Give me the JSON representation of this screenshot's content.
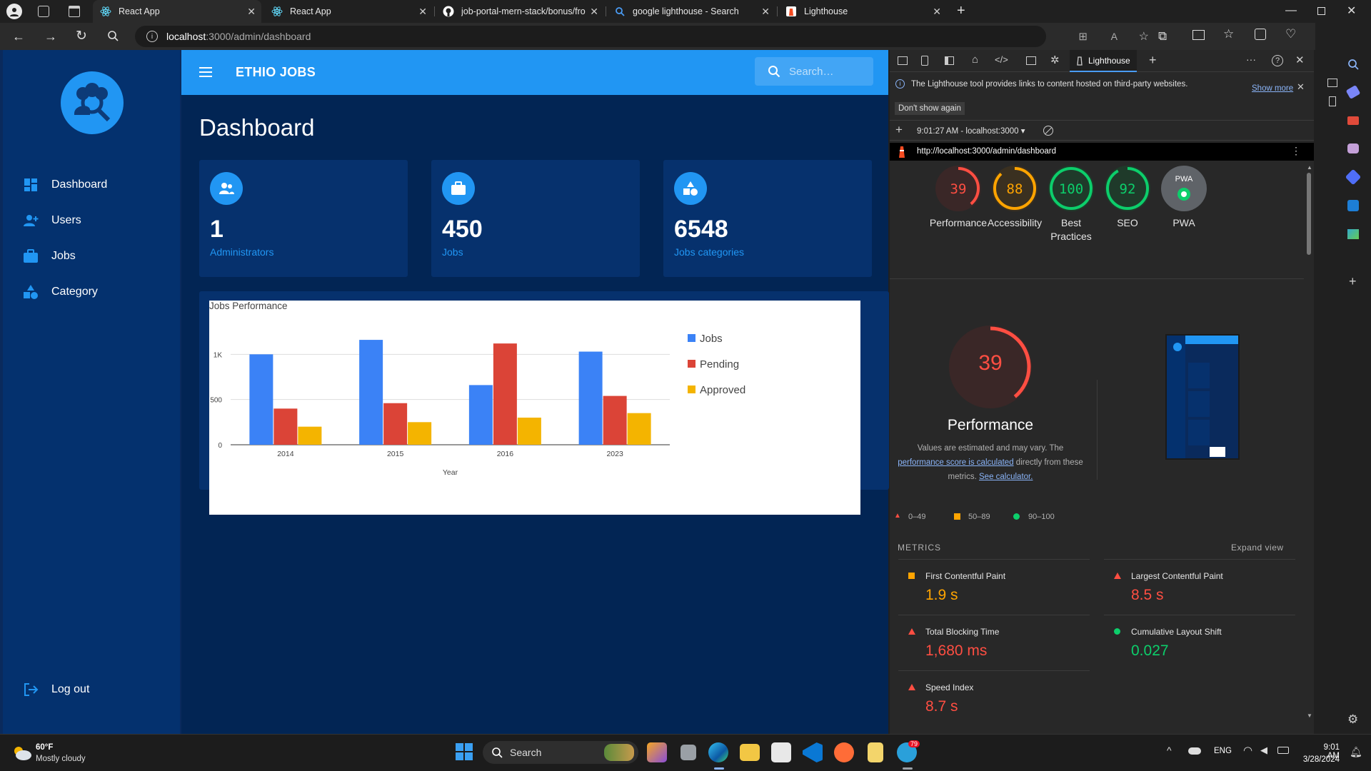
{
  "browser": {
    "tabs": [
      {
        "title": "React App"
      },
      {
        "title": "React App"
      },
      {
        "title": "job-portal-mern-stack/bonus/fro"
      },
      {
        "title": "google lighthouse - Search"
      },
      {
        "title": "Lighthouse"
      }
    ],
    "url_host": "localhost",
    "url_rest": ":3000/admin/dashboard"
  },
  "app": {
    "brand": "ETHIO JOBS",
    "search_placeholder": "Search…",
    "page_title": "Dashboard",
    "nav": [
      {
        "label": "Dashboard",
        "icon": "dashboard-icon"
      },
      {
        "label": "Users",
        "icon": "group-add-icon"
      },
      {
        "label": "Jobs",
        "icon": "work-icon"
      },
      {
        "label": "Category",
        "icon": "category-icon"
      }
    ],
    "logout": "Log out",
    "cards": [
      {
        "value": "1",
        "label": "Administrators",
        "icon": "supervisor-icon"
      },
      {
        "value": "450",
        "label": "Jobs",
        "icon": "work-icon"
      },
      {
        "value": "6548",
        "label": "Jobs categories",
        "icon": "category-icon"
      }
    ],
    "colors": {
      "primary": "#2196f3",
      "sidebar": "#04316e",
      "main": "#022554",
      "card": "#06316d"
    }
  },
  "chart_data": {
    "type": "bar",
    "title": "Jobs Performance",
    "xlabel": "Year",
    "ylabel": "",
    "categories": [
      "2014",
      "2015",
      "2016",
      "2023"
    ],
    "series": [
      {
        "name": "Jobs",
        "color": "#3b82f6",
        "values": [
          1000,
          1160,
          660,
          1030
        ]
      },
      {
        "name": "Pending",
        "color": "#db4437",
        "values": [
          400,
          460,
          1120,
          540
        ]
      },
      {
        "name": "Approved",
        "color": "#f4b400",
        "values": [
          200,
          250,
          300,
          350
        ]
      }
    ],
    "yticks": [
      "0",
      "500",
      "1K"
    ],
    "ylim": [
      0,
      1200
    ],
    "legend": "right",
    "grid": true
  },
  "devtools": {
    "panel_tab": "Lighthouse",
    "info": "The Lighthouse tool provides links to content hosted on third-party websites.",
    "show_more": "Show more",
    "dont_show": "Don't show again",
    "report_select": "9:01:27 AM - localhost:3000",
    "report_url": "http://localhost:3000/admin/dashboard",
    "scores": [
      {
        "label": "Performance",
        "value": "39",
        "score": 39,
        "color": "#ff4e42"
      },
      {
        "label": "Accessibility",
        "value": "88",
        "score": 88,
        "color": "#ffa400"
      },
      {
        "label": "Best Practices",
        "value": "100",
        "score": 100,
        "color": "#0cce6b"
      },
      {
        "label": "SEO",
        "value": "92",
        "score": 92,
        "color": "#0cce6b"
      },
      {
        "label": "PWA",
        "value": "PWA",
        "score": null,
        "color": "#9e9e9e"
      }
    ],
    "big_score": "39",
    "big_label": "Performance",
    "desc1": "Values are estimated and may vary. The",
    "desc_link": "performance score is calculated",
    "desc2": "directly from these",
    "desc3": "metrics.",
    "see_calc": "See calculator.",
    "legend": {
      "red": "0–49",
      "orange": "50–89",
      "green": "90–100"
    },
    "metrics_title": "METRICS",
    "expand": "Expand view",
    "metrics": [
      {
        "name": "First Contentful Paint",
        "value": "1.9 s",
        "status": "average"
      },
      {
        "name": "Largest Contentful Paint",
        "value": "8.5 s",
        "status": "fail"
      },
      {
        "name": "Total Blocking Time",
        "value": "1,680 ms",
        "status": "fail"
      },
      {
        "name": "Cumulative Layout Shift",
        "value": "0.027",
        "status": "pass"
      },
      {
        "name": "Speed Index",
        "value": "8.7 s",
        "status": "fail"
      }
    ]
  },
  "taskbar": {
    "temp": "60°F",
    "weather": "Mostly cloudy",
    "search": "Search",
    "lang": "ENG",
    "time": "9:01 AM",
    "date": "3/28/2024",
    "badge": "79"
  }
}
